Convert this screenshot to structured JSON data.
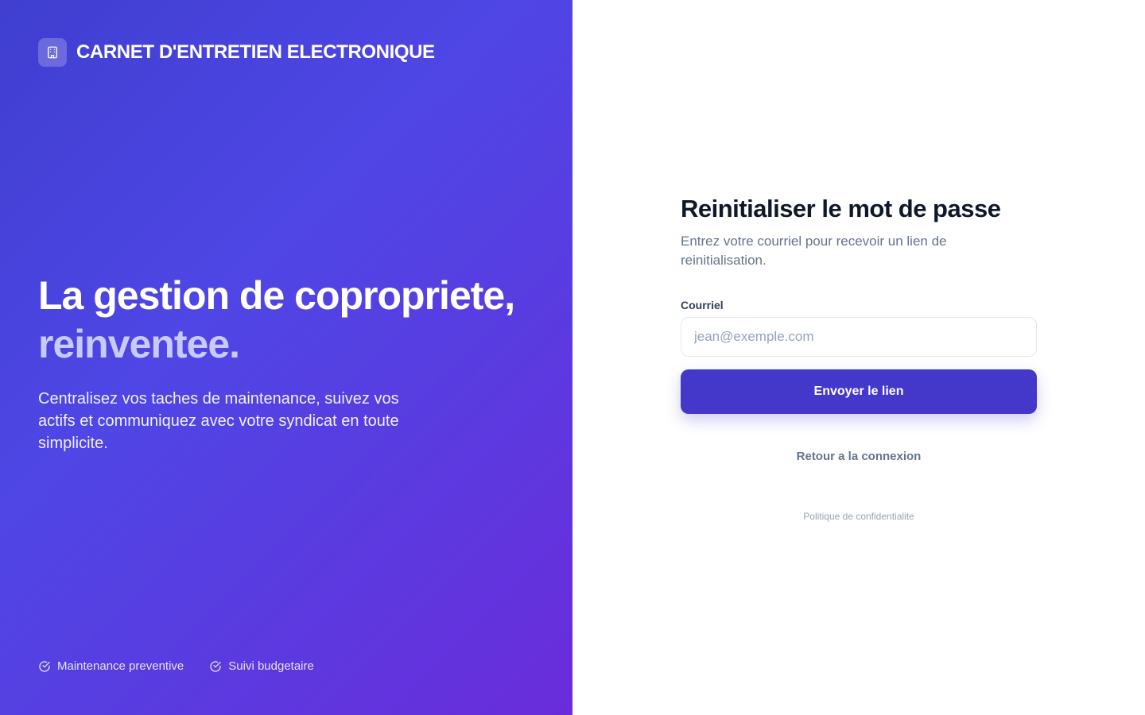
{
  "brand": {
    "title": "CARNET D'ENTRETIEN ELECTRONIQUE",
    "icon": "building-icon"
  },
  "hero": {
    "headline_line1": "La gestion de copropriete,",
    "headline_line2": "reinventee.",
    "tagline": "Centralisez vos taches de maintenance, suivez vos actifs et communiquez avec votre syndicat en toute simplicite.",
    "features": [
      {
        "label": "Maintenance preventive",
        "icon": "check-circle-icon"
      },
      {
        "label": "Suivi budgetaire",
        "icon": "check-circle-icon"
      }
    ]
  },
  "form": {
    "title": "Reinitialiser le mot de passe",
    "subtitle": "Entrez votre courriel pour recevoir un lien de reinitialisation.",
    "email_label": "Courriel",
    "email_placeholder": "jean@exemple.com",
    "email_value": "",
    "submit_label": "Envoyer le lien",
    "back_link": "Retour a la connexion",
    "privacy_link": "Politique de confidentialite"
  },
  "colors": {
    "primary": "#4338ca",
    "hero_gradient_start": "#3f3fd0",
    "hero_gradient_end": "#6a2cdb",
    "accent_text": "#c7cbff"
  }
}
